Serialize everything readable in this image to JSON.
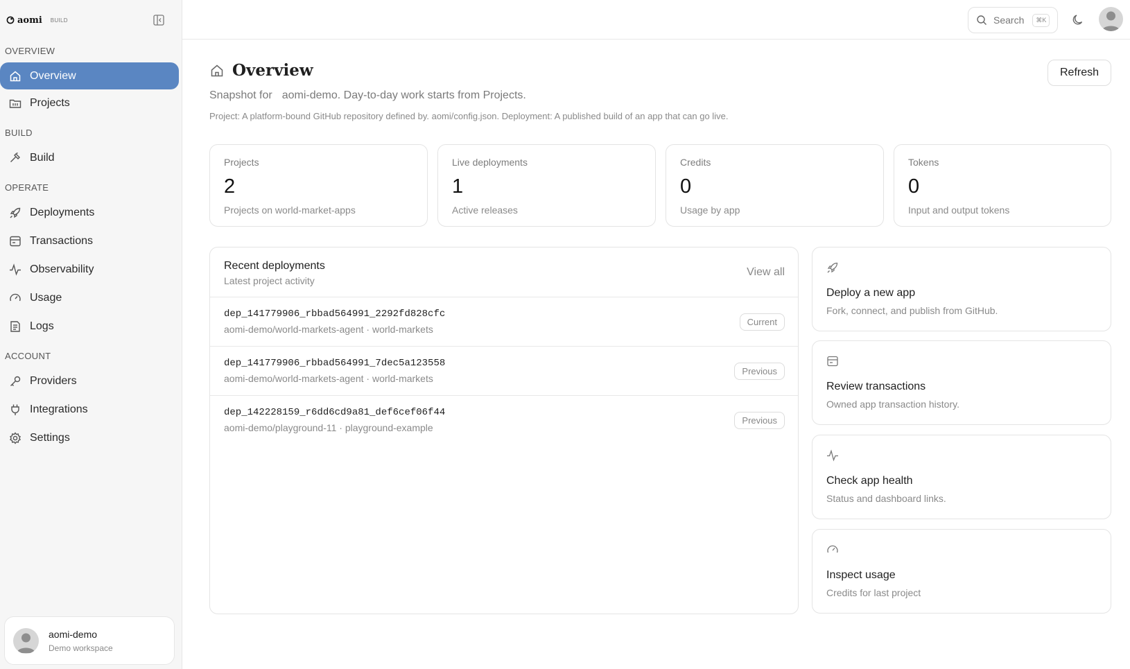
{
  "brand": {
    "name": "aomi",
    "tag": "BUILD"
  },
  "sidebar": {
    "sections": {
      "overview": "OVERVIEW",
      "build": "BUILD",
      "operate": "OPERATE",
      "account": "ACCOUNT"
    },
    "items": [
      {
        "label": "Overview",
        "icon": "home-icon",
        "active": true
      },
      {
        "label": "Projects",
        "icon": "projects-icon"
      },
      {
        "label": "Build",
        "icon": "hammer-icon"
      },
      {
        "label": "Deployments",
        "icon": "rocket-icon"
      },
      {
        "label": "Transactions",
        "icon": "transactions-icon"
      },
      {
        "label": "Observability",
        "icon": "activity-icon"
      },
      {
        "label": "Usage",
        "icon": "gauge-icon"
      },
      {
        "label": "Logs",
        "icon": "logs-icon"
      },
      {
        "label": "Providers",
        "icon": "key-icon"
      },
      {
        "label": "Integrations",
        "icon": "plug-icon"
      },
      {
        "label": "Settings",
        "icon": "gear-icon"
      }
    ],
    "user": {
      "name": "aomi-demo",
      "subtitle": "Demo workspace"
    }
  },
  "topbar": {
    "search": {
      "label": "Search",
      "shortcut": "⌘K"
    }
  },
  "page": {
    "title": "Overview",
    "refresh_label": "Refresh",
    "snapshot_prefix": "Snapshot for",
    "snapshot_text": "aomi-demo. Day-to-day work starts from Projects.",
    "definitions": "Project: A platform-bound GitHub repository defined by. aomi/config.json. Deployment: A published build of an app that can go live."
  },
  "stats": [
    {
      "label": "Projects",
      "value": "2",
      "sub": "Projects on world-market-apps"
    },
    {
      "label": "Live deployments",
      "value": "1",
      "sub": "Active releases"
    },
    {
      "label": "Credits",
      "value": "0",
      "sub": "Usage by app"
    },
    {
      "label": "Tokens",
      "value": "0",
      "sub": "Input and output tokens"
    }
  ],
  "recent": {
    "title": "Recent deployments",
    "subtitle": "Latest project activity",
    "view_all": "View all",
    "rows": [
      {
        "id": "dep_141779906_rbbad564991_2292fd828cfc",
        "meta": "aomi-demo/world-markets-agent · world-markets",
        "badge": "Current"
      },
      {
        "id": "dep_141779906_rbbad564991_7dec5a123558",
        "meta": "aomi-demo/world-markets-agent · world-markets",
        "badge": "Previous"
      },
      {
        "id": "dep_142228159_r6dd6cd9a81_def6cef06f44",
        "meta": "aomi-demo/playground-11 · playground-example",
        "badge": "Previous"
      }
    ]
  },
  "actions": [
    {
      "title": "Deploy a new app",
      "sub": "Fork, connect, and publish from GitHub.",
      "icon": "rocket-icon"
    },
    {
      "title": "Review transactions",
      "sub": "Owned app transaction history.",
      "icon": "transactions-icon"
    },
    {
      "title": "Check app health",
      "sub": "Status and dashboard links.",
      "icon": "activity-icon"
    },
    {
      "title": "Inspect usage",
      "sub": "Credits for last project",
      "icon": "gauge-icon"
    }
  ]
}
